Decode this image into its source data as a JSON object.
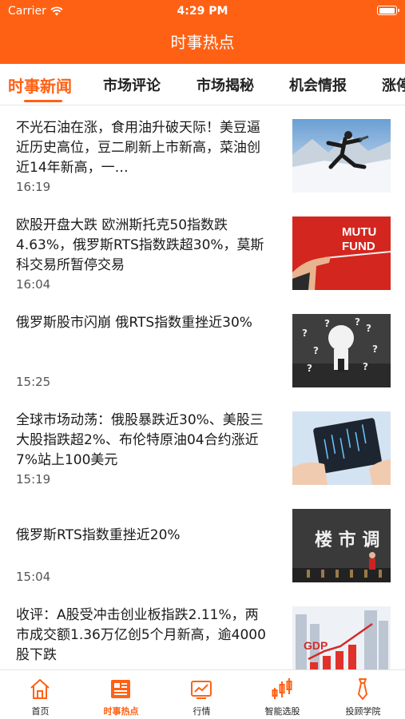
{
  "status_bar": {
    "carrier": "Carrier",
    "time": "4:29 PM"
  },
  "nav": {
    "title": "时事热点"
  },
  "tabs": [
    {
      "label": "时事新闻",
      "active": true
    },
    {
      "label": "市场评论",
      "active": false
    },
    {
      "label": "市场揭秘",
      "active": false
    },
    {
      "label": "机会情报",
      "active": false
    },
    {
      "label": "涨停",
      "active": false
    }
  ],
  "news": [
    {
      "title": "不光石油在涨，食用油升破天际！美豆逼近历史高位，豆二刷新上市新高，菜油创近14年新高，一…",
      "time": "16:19"
    },
    {
      "title": "欧股开盘大跌 欧洲斯托克50指数跌4.63%，俄罗斯RTS指数跌超30%，莫斯科交易所暂停交易",
      "time": "16:04"
    },
    {
      "title": "俄罗斯股市闪崩 俄RTS指数重挫近30%",
      "time": "15:25"
    },
    {
      "title": "全球市场动荡：俄股暴跌近30%、美股三大股指跌超2%、布伦特原油04合约涨近7%站上100美元",
      "time": "15:19"
    },
    {
      "title": "俄罗斯RTS指数重挫近20%",
      "time": "15:04"
    },
    {
      "title": "收评：A股受冲击创业板指跌2.11%，两市成交额1.36万亿创5个月新高，逾4000股下跌",
      "time": ""
    }
  ],
  "thumb_text": {
    "mutual": "MUTU",
    "fund": "FUND",
    "loushi": "楼 市 调",
    "gdp": "GDP"
  },
  "tabbar": [
    {
      "label": "首页",
      "icon": "home-icon",
      "active": false
    },
    {
      "label": "时事热点",
      "icon": "news-icon",
      "active": true
    },
    {
      "label": "行情",
      "icon": "chart-icon",
      "active": false
    },
    {
      "label": "智能选股",
      "icon": "candlestick-icon",
      "active": false
    },
    {
      "label": "投顾学院",
      "icon": "tie-icon",
      "active": false
    }
  ],
  "colors": {
    "accent": "#ff6114",
    "text": "#1a1a1a",
    "muted": "#555555"
  }
}
